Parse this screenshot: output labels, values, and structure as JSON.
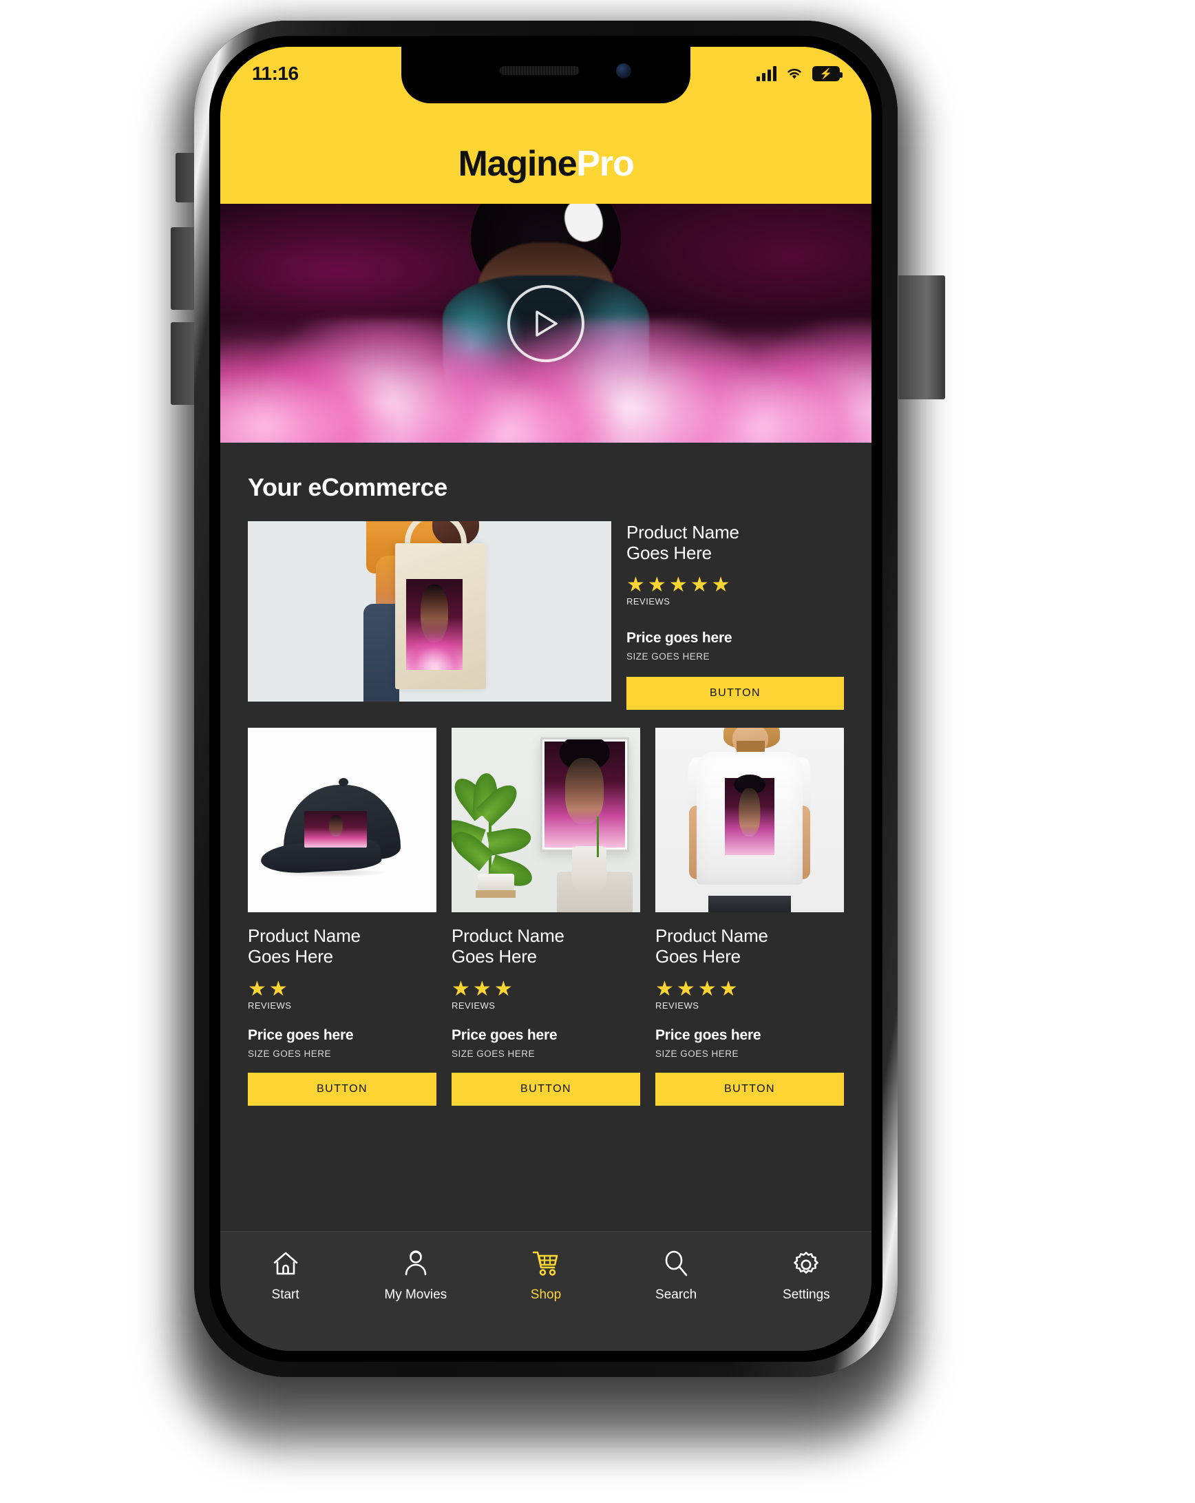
{
  "status_bar": {
    "time": "11:16",
    "signal_icon": "cellular-signal-icon",
    "wifi_icon": "wifi-icon",
    "battery_icon": "battery-charging-icon"
  },
  "header": {
    "logo_primary": "Magine",
    "logo_secondary": "Pro",
    "background_color": "#FCD535"
  },
  "hero": {
    "play_button_label": "play-button",
    "alt": "Woman in leather jacket with pink smoke"
  },
  "section": {
    "title": "Your eCommerce"
  },
  "featured_product": {
    "name": "Product Name\nGoes Here",
    "name_line1": "Product Name",
    "name_line2": "Goes Here",
    "rating": 5,
    "reviews_label": "REVIEWS",
    "price": "Price goes here",
    "size": "SIZE GOES HERE",
    "button_label": "BUTTON",
    "image": "tote-bag-product-image"
  },
  "products": [
    {
      "name_line1": "Product Name",
      "name_line2": "Goes Here",
      "rating": 2,
      "reviews_label": "REVIEWS",
      "price": "Price goes here",
      "size": "SIZE GOES HERE",
      "button_label": "BUTTON",
      "image": "cap-product-image"
    },
    {
      "name_line1": "Product Name",
      "name_line2": "Goes Here",
      "rating": 3,
      "reviews_label": "REVIEWS",
      "price": "Price goes here",
      "size": "SIZE GOES HERE",
      "button_label": "BUTTON",
      "image": "framed-poster-product-image"
    },
    {
      "name_line1": "Product Name",
      "name_line2": "Goes Here",
      "rating": 4,
      "reviews_label": "REVIEWS",
      "price": "Price goes here",
      "size": "SIZE GOES HERE",
      "button_label": "BUTTON",
      "image": "tshirt-product-image"
    }
  ],
  "tabbar": {
    "items": [
      {
        "label": "Start",
        "icon": "home-icon",
        "active": false
      },
      {
        "label": "My Movies",
        "icon": "person-icon",
        "active": false
      },
      {
        "label": "Shop",
        "icon": "cart-icon",
        "active": true
      },
      {
        "label": "Search",
        "icon": "search-icon",
        "active": false
      },
      {
        "label": "Settings",
        "icon": "gear-icon",
        "active": false
      }
    ]
  },
  "theme": {
    "accent": "#FCD535",
    "background": "#2C2C2C",
    "tabbar_background": "#333333",
    "star_color": "#FCD535",
    "text_primary": "#FFFFFF"
  }
}
